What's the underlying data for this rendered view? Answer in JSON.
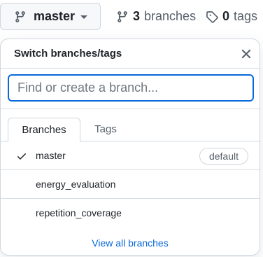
{
  "header": {
    "current_branch": "master",
    "branches_count": "3",
    "branches_label": "branches",
    "tags_count": "0",
    "tags_label": "tags"
  },
  "panel": {
    "title": "Switch branches/tags",
    "search_placeholder": "Find or create a branch...",
    "tabs": [
      {
        "label": "Branches",
        "selected": true
      },
      {
        "label": "Tags",
        "selected": false
      }
    ],
    "branches": [
      {
        "name": "master",
        "checked": true,
        "badge": "default"
      },
      {
        "name": "energy_evaluation",
        "checked": false
      },
      {
        "name": "repetition_coverage",
        "checked": false
      }
    ],
    "view_all_label": "View all branches"
  },
  "colors": {
    "accent": "#0969da",
    "border": "#d0d7de",
    "button_bg": "#f6f8fa"
  }
}
